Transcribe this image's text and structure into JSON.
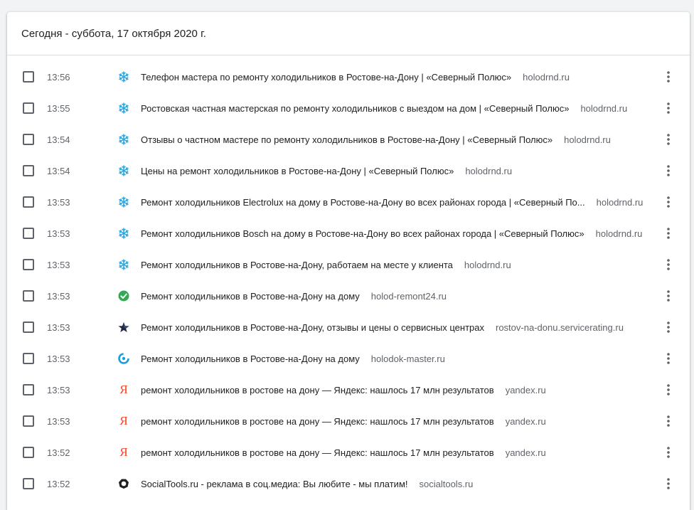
{
  "header": {
    "title": "Сегодня - суббота, 17 октября 2020 г."
  },
  "colors": {
    "snowflake": "#2aa8e0",
    "check": "#34a853",
    "star": "#1f2a44",
    "yandex": "#fc3f1d",
    "holodok": "#1aa0d6"
  },
  "entries": [
    {
      "time": "13:56",
      "icon": "snowflake-icon",
      "title": "Телефон мастера по ремонту холодильников в Ростове-на-Дону | «Северный Полюс»",
      "domain": "holodrnd.ru"
    },
    {
      "time": "13:55",
      "icon": "snowflake-icon",
      "title": "Ростовская частная мастерская по ремонту холодильников с выездом на дом | «Северный Полюс»",
      "domain": "holodrnd.ru"
    },
    {
      "time": "13:54",
      "icon": "snowflake-icon",
      "title": "Отзывы о частном мастере по ремонту холодильников в Ростове-на-Дону | «Северный Полюс»",
      "domain": "holodrnd.ru"
    },
    {
      "time": "13:54",
      "icon": "snowflake-icon",
      "title": "Цены на ремонт холодильников в Ростове-на-Дону | «Северный Полюс»",
      "domain": "holodrnd.ru"
    },
    {
      "time": "13:53",
      "icon": "snowflake-icon",
      "title": "Ремонт холодильников Electrolux на дому в Ростове-на-Дону во всех районах города | «Северный По...",
      "domain": "holodrnd.ru"
    },
    {
      "time": "13:53",
      "icon": "snowflake-icon",
      "title": "Ремонт холодильников Bosch на дому в Ростове-на-Дону во всех районах города | «Северный Полюс»",
      "domain": "holodrnd.ru"
    },
    {
      "time": "13:53",
      "icon": "snowflake-icon",
      "title": "Ремонт холодильников в Ростове-на-Дону, работаем на месте у клиента",
      "domain": "holodrnd.ru"
    },
    {
      "time": "13:53",
      "icon": "green-check-icon",
      "title": "Ремонт холодильников в Ростове-на-Дону на дому",
      "domain": "holod-remont24.ru"
    },
    {
      "time": "13:53",
      "icon": "star-icon",
      "title": "Ремонт холодильников в Ростове-на-Дону, отзывы и цены о сервисных центрах",
      "domain": "rostov-na-donu.servicerating.ru"
    },
    {
      "time": "13:53",
      "icon": "holodok-logo-icon",
      "title": "Ремонт холодильников в Ростове-на-Дону на дому",
      "domain": "holodok-master.ru"
    },
    {
      "time": "13:53",
      "icon": "yandex-icon",
      "glyph": "Я",
      "title": "ремонт холодильников в ростове на дону — Яндекс: нашлось 17 млн результатов",
      "domain": "yandex.ru"
    },
    {
      "time": "13:53",
      "icon": "yandex-icon",
      "glyph": "Я",
      "title": "ремонт холодильников в ростове на дону — Яндекс: нашлось 17 млн результатов",
      "domain": "yandex.ru"
    },
    {
      "time": "13:52",
      "icon": "yandex-icon",
      "glyph": "Я",
      "title": "ремонт холодильников в ростове на дону — Яндекс: нашлось 17 млн результатов",
      "domain": "yandex.ru"
    },
    {
      "time": "13:52",
      "icon": "socialtools-icon",
      "title": "SocialTools.ru - реклама в соц.медиа: Вы любите - мы платим!",
      "domain": "socialtools.ru"
    }
  ]
}
